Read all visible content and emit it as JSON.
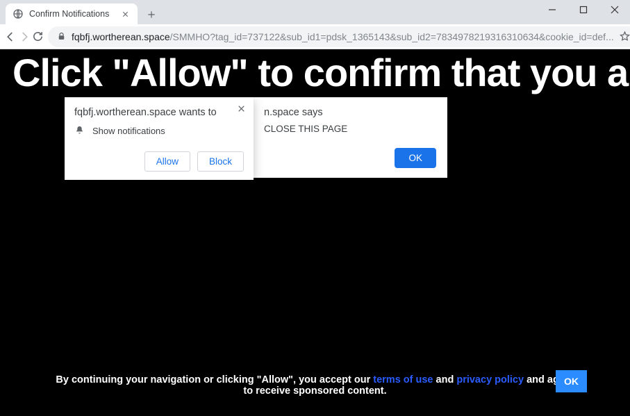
{
  "window": {
    "tab_title": "Confirm Notifications"
  },
  "toolbar": {
    "url_host": "fqbfj.wortherean.space",
    "url_path": "/SMMHO?tag_id=737122&sub_id1=pdsk_1365143&sub_id2=7834978219316310634&cookie_id=def..."
  },
  "page": {
    "headline": "Click \"Allow\" to confirm that you are"
  },
  "permission_prompt": {
    "origin_text": "fqbfj.wortherean.space wants to",
    "permission_label": "Show notifications",
    "allow_label": "Allow",
    "block_label": "Block"
  },
  "js_alert": {
    "says_text": "n.space says",
    "message": "CLOSE THIS PAGE",
    "ok_label": "OK"
  },
  "cookie_banner": {
    "text_1": "By continuing your navigation or clicking \"Allow\", you accept our ",
    "terms_label": "terms of use",
    "text_2": " and ",
    "privacy_label": "privacy policy",
    "text_3": " and agree to receive sponsored content.",
    "ok_label": "OK"
  }
}
